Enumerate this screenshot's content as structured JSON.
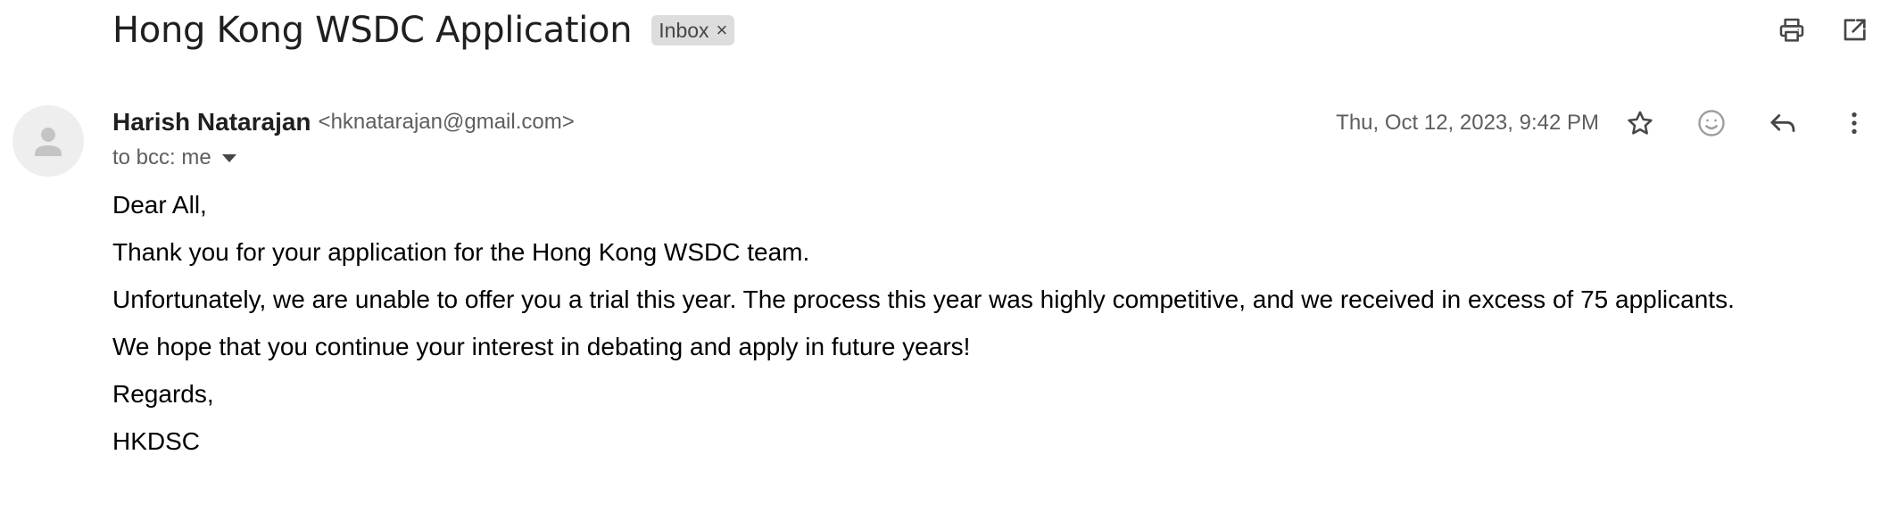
{
  "email": {
    "subject": "Hong Kong WSDC Application",
    "label": "Inbox",
    "label_close": "×",
    "sender": {
      "name": "Harish Natarajan",
      "email": "<hknatarajan@gmail.com>"
    },
    "recipients": "to bcc: me",
    "date": "Thu, Oct 12, 2023, 9:42 PM",
    "body": [
      "Dear All,",
      "Thank you for your application for the Hong Kong WSDC team.",
      "Unfortunately, we are unable to offer you a trial this year. The process this year was highly competitive, and we received in excess of 75 applicants.",
      "We hope that you continue your interest in debating and apply in future years!",
      "Regards,",
      "HKDSC"
    ]
  },
  "icons": {
    "print": "print-icon",
    "open_new_window": "open-in-new-window-icon",
    "avatar": "person-icon",
    "star": "star-icon",
    "emoji": "emoji-icon",
    "reply": "reply-icon",
    "more": "more-vert-icon",
    "recipient_dropdown": "caret-down-icon"
  },
  "colors": {
    "chip_bg": "#dddddd",
    "icon": "#444746",
    "secondary_text": "#5e5e5e",
    "avatar_bg": "#eeeeee"
  }
}
